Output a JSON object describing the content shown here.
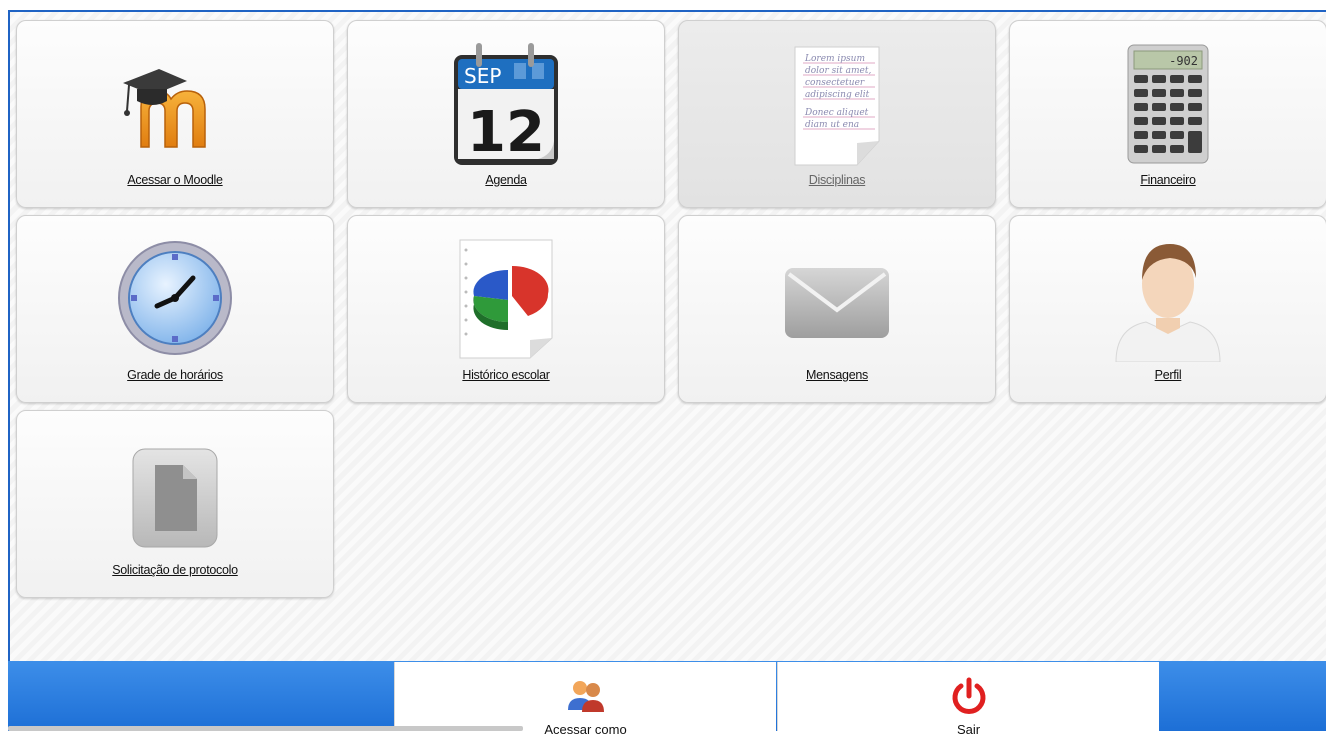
{
  "tiles": [
    {
      "label": "Acessar o Moodle",
      "icon": "moodle-icon"
    },
    {
      "label": "Agenda",
      "icon": "calendar-icon",
      "calendar_month": "SEP",
      "calendar_day": "12"
    },
    {
      "label": "Disciplinas",
      "icon": "document-icon",
      "note_lines": [
        "Lorem ipsum",
        "dolor sit amet,",
        "consectetuer",
        "adipiscing elit",
        "Donec aliquet",
        "diam ut ena"
      ]
    },
    {
      "label": "Financeiro",
      "icon": "calculator-icon",
      "calculator_display": "-902"
    },
    {
      "label": "Grade de horários",
      "icon": "clock-icon"
    },
    {
      "label": "Histórico escolar",
      "icon": "pie-chart-report-icon"
    },
    {
      "label": "Mensagens",
      "icon": "envelope-icon"
    },
    {
      "label": "Perfil",
      "icon": "user-profile-icon"
    },
    {
      "label": "Solicitação de protocolo",
      "icon": "file-icon"
    }
  ],
  "bottom_actions": [
    {
      "label": "Acessar como",
      "icon": "users-icon"
    },
    {
      "label": "Sair",
      "icon": "power-icon"
    }
  ],
  "colors": {
    "frame_border": "#1f63c4",
    "bottom_bar": "#2a7de0",
    "power_red": "#e02020"
  }
}
